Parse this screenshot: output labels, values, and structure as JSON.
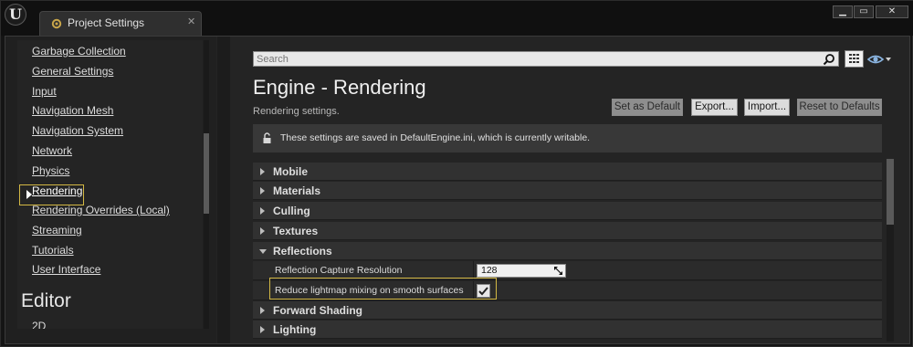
{
  "window": {
    "tab_title": "Project Settings",
    "tab_close": "✕",
    "minimize": "▁",
    "maximize": "▭",
    "close": "✕",
    "logo": "U"
  },
  "sidebar": {
    "items": [
      {
        "label": "Garbage Collection"
      },
      {
        "label": "General Settings"
      },
      {
        "label": "Input"
      },
      {
        "label": "Navigation Mesh"
      },
      {
        "label": "Navigation System"
      },
      {
        "label": "Network"
      },
      {
        "label": "Physics"
      },
      {
        "label": "Rendering",
        "selected": true
      },
      {
        "label": "Rendering Overrides (Local)"
      },
      {
        "label": "Streaming"
      },
      {
        "label": "Tutorials"
      },
      {
        "label": "User Interface"
      }
    ],
    "section_heading": "Editor",
    "next_item": "2D"
  },
  "search": {
    "placeholder": "Search",
    "icon": "search-icon"
  },
  "header": {
    "title": "Engine - Rendering",
    "subtitle": "Rendering settings."
  },
  "actions": {
    "set_default": "Set as Default",
    "export": "Export...",
    "import": "Import...",
    "reset": "Reset to Defaults"
  },
  "info": {
    "text": "These settings are saved in DefaultEngine.ini, which is currently writable."
  },
  "categories": [
    {
      "label": "Mobile",
      "expanded": false
    },
    {
      "label": "Materials",
      "expanded": false
    },
    {
      "label": "Culling",
      "expanded": false
    },
    {
      "label": "Textures",
      "expanded": false
    },
    {
      "label": "Reflections",
      "expanded": true
    },
    {
      "label": "Forward Shading",
      "expanded": false
    },
    {
      "label": "Lighting",
      "expanded": false
    }
  ],
  "reflection_props": {
    "capture_resolution_label": "Reflection Capture Resolution",
    "capture_resolution_value": "128",
    "reduce_lightmap_label": "Reduce lightmap mixing on smooth surfaces",
    "reduce_lightmap_checked": true
  },
  "colors": {
    "highlight": "#d3b844",
    "panel": "#242424",
    "category_row": "#313131"
  }
}
